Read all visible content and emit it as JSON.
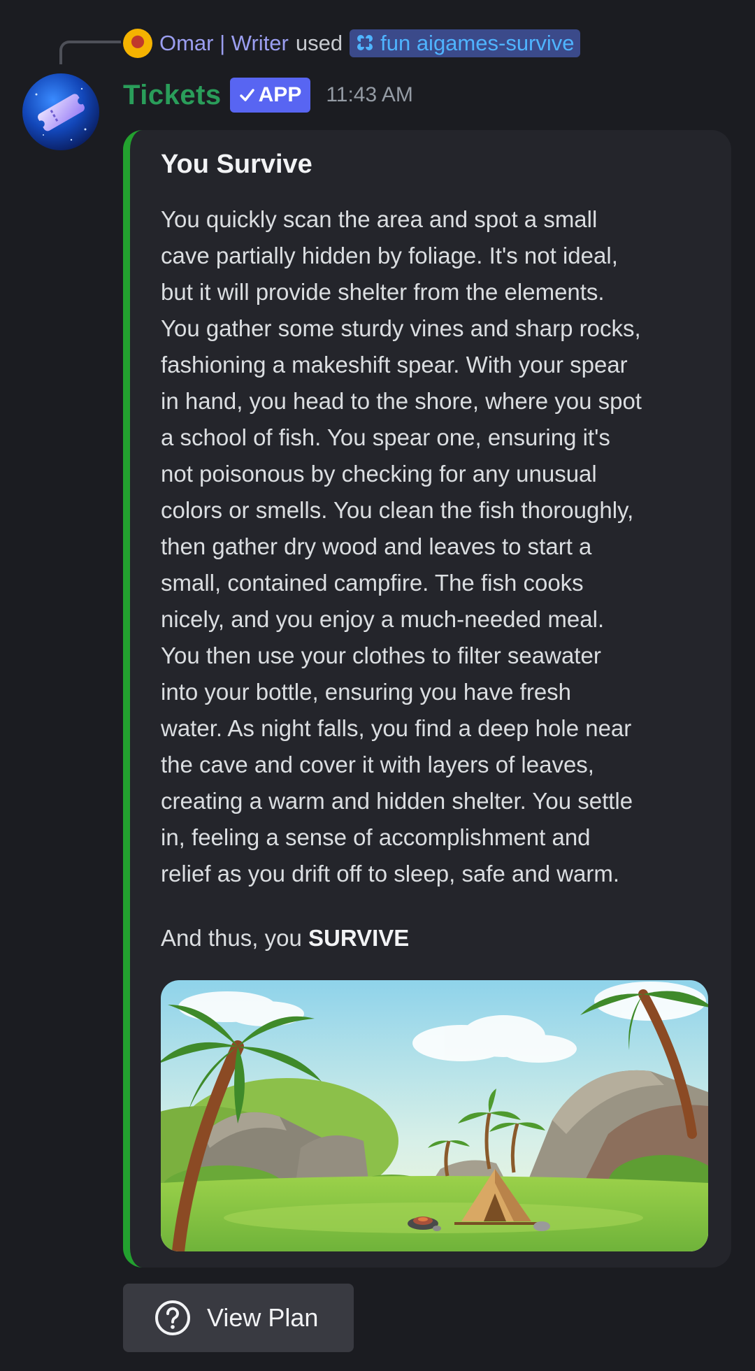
{
  "reply": {
    "username": "Omar | Writer",
    "used_text": "used",
    "command": "fun aigames-survive"
  },
  "message": {
    "bot_name": "Tickets",
    "badge": "APP",
    "timestamp": "11:43 AM"
  },
  "embed": {
    "accent_color": "#23a12f",
    "title": "You Survive",
    "description_lines": [
      "You quickly scan the area and spot a small",
      "cave partially hidden by foliage. It's not ideal,",
      "but it will provide shelter from the elements.",
      "You gather some sturdy vines and sharp rocks,",
      "fashioning a makeshift spear. With your spear",
      "in hand, you head to the shore, where you spot",
      "a school of fish. You spear one, ensuring it's",
      "not poisonous by checking for any unusual",
      "colors or smells. You clean the fish thoroughly,",
      "then gather dry wood and leaves to start a",
      "small, contained campfire. The fish cooks",
      "nicely, and you enjoy a much-needed meal.",
      "You then use your clothes to filter seawater",
      "into your bottle, ensuring you have fresh",
      "water. As night falls, you find a deep hole near",
      "the cave and cover it with layers of leaves,",
      "creating a warm and hidden shelter. You settle",
      "in, feeling a sense of accomplishment and",
      "relief as you drift off to sleep, safe and warm."
    ],
    "outro_prefix": "And thus, you ",
    "outro_bold": "SURVIVE"
  },
  "button": {
    "label": "View Plan",
    "icon": "question-circle-icon"
  },
  "colors": {
    "background": "#1b1c21",
    "embed_background": "#24252b",
    "bot_name": "#2a9d5a",
    "badge": "#5865f2",
    "command_text": "#4fb4ff"
  }
}
